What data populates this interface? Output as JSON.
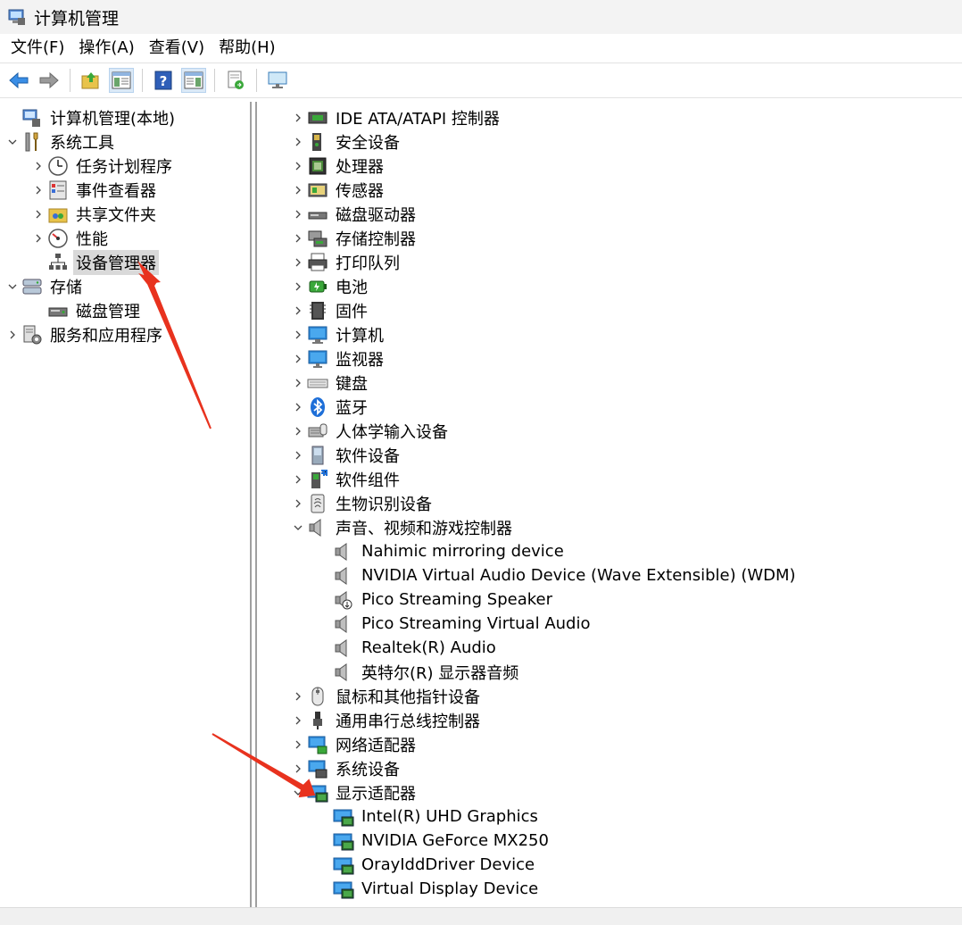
{
  "window": {
    "title": "计算机管理"
  },
  "menu": [
    "文件(F)",
    "操作(A)",
    "查看(V)",
    "帮助(H)"
  ],
  "toolbar_icons": [
    "back-arrow-icon",
    "forward-arrow-icon",
    "up-folder-icon",
    "show-tree-icon",
    "help-icon",
    "properties-icon",
    "export-icon",
    "monitor-icon"
  ],
  "left_tree": [
    {
      "label": "计算机管理(本地)",
      "icon": "computer-management-icon",
      "level": 0,
      "expander": "none"
    },
    {
      "label": "系统工具",
      "icon": "tools-icon",
      "level": 0,
      "expander": "open"
    },
    {
      "label": "任务计划程序",
      "icon": "clock-icon",
      "level": 1,
      "expander": "closed"
    },
    {
      "label": "事件查看器",
      "icon": "event-viewer-icon",
      "level": 1,
      "expander": "closed"
    },
    {
      "label": "共享文件夹",
      "icon": "shared-folder-icon",
      "level": 1,
      "expander": "closed"
    },
    {
      "label": "性能",
      "icon": "performance-icon",
      "level": 1,
      "expander": "closed"
    },
    {
      "label": "设备管理器",
      "icon": "device-manager-icon",
      "level": 1,
      "expander": "none",
      "selected": true
    },
    {
      "label": "存储",
      "icon": "storage-icon",
      "level": 0,
      "expander": "open"
    },
    {
      "label": "磁盘管理",
      "icon": "disk-management-icon",
      "level": 1,
      "expander": "none"
    },
    {
      "label": "服务和应用程序",
      "icon": "services-icon",
      "level": 0,
      "expander": "closed"
    }
  ],
  "device_tree": [
    {
      "label": "IDE ATA/ATAPI 控制器",
      "icon": "ide-controller-icon",
      "level": 0,
      "expander": "closed"
    },
    {
      "label": "安全设备",
      "icon": "security-device-icon",
      "level": 0,
      "expander": "closed"
    },
    {
      "label": "处理器",
      "icon": "processor-icon",
      "level": 0,
      "expander": "closed"
    },
    {
      "label": "传感器",
      "icon": "sensor-icon",
      "level": 0,
      "expander": "closed"
    },
    {
      "label": "磁盘驱动器",
      "icon": "disk-drive-icon",
      "level": 0,
      "expander": "closed"
    },
    {
      "label": "存储控制器",
      "icon": "storage-controller-icon",
      "level": 0,
      "expander": "closed"
    },
    {
      "label": "打印队列",
      "icon": "printer-icon",
      "level": 0,
      "expander": "closed"
    },
    {
      "label": "电池",
      "icon": "battery-icon",
      "level": 0,
      "expander": "closed"
    },
    {
      "label": "固件",
      "icon": "firmware-icon",
      "level": 0,
      "expander": "closed"
    },
    {
      "label": "计算机",
      "icon": "computer-icon",
      "level": 0,
      "expander": "closed"
    },
    {
      "label": "监视器",
      "icon": "monitor-icon",
      "level": 0,
      "expander": "closed"
    },
    {
      "label": "键盘",
      "icon": "keyboard-icon",
      "level": 0,
      "expander": "closed"
    },
    {
      "label": "蓝牙",
      "icon": "bluetooth-icon",
      "level": 0,
      "expander": "closed"
    },
    {
      "label": "人体学输入设备",
      "icon": "hid-icon",
      "level": 0,
      "expander": "closed"
    },
    {
      "label": "软件设备",
      "icon": "software-device-icon",
      "level": 0,
      "expander": "closed"
    },
    {
      "label": "软件组件",
      "icon": "software-component-icon",
      "level": 0,
      "expander": "closed"
    },
    {
      "label": "生物识别设备",
      "icon": "biometric-icon",
      "level": 0,
      "expander": "closed"
    },
    {
      "label": "声音、视频和游戏控制器",
      "icon": "speaker-icon",
      "level": 0,
      "expander": "open"
    },
    {
      "label": "Nahimic mirroring device",
      "icon": "speaker-icon",
      "level": 1,
      "expander": "none"
    },
    {
      "label": "NVIDIA Virtual Audio Device (Wave Extensible) (WDM)",
      "icon": "speaker-icon",
      "level": 1,
      "expander": "none"
    },
    {
      "label": "Pico Streaming Speaker",
      "icon": "speaker-download-icon",
      "level": 1,
      "expander": "none"
    },
    {
      "label": "Pico Streaming Virtual Audio",
      "icon": "speaker-icon",
      "level": 1,
      "expander": "none"
    },
    {
      "label": "Realtek(R) Audio",
      "icon": "speaker-icon",
      "level": 1,
      "expander": "none"
    },
    {
      "label": "英特尔(R) 显示器音频",
      "icon": "speaker-icon",
      "level": 1,
      "expander": "none"
    },
    {
      "label": "鼠标和其他指针设备",
      "icon": "mouse-icon",
      "level": 0,
      "expander": "closed"
    },
    {
      "label": "通用串行总线控制器",
      "icon": "usb-icon",
      "level": 0,
      "expander": "closed"
    },
    {
      "label": "网络适配器",
      "icon": "network-adapter-icon",
      "level": 0,
      "expander": "closed"
    },
    {
      "label": "系统设备",
      "icon": "system-device-icon",
      "level": 0,
      "expander": "closed"
    },
    {
      "label": "显示适配器",
      "icon": "display-adapter-icon",
      "level": 0,
      "expander": "open"
    },
    {
      "label": "Intel(R) UHD Graphics",
      "icon": "display-adapter-icon",
      "level": 1,
      "expander": "none"
    },
    {
      "label": "NVIDIA GeForce MX250",
      "icon": "display-adapter-icon",
      "level": 1,
      "expander": "none"
    },
    {
      "label": "OrayIddDriver Device",
      "icon": "display-adapter-icon",
      "level": 1,
      "expander": "none"
    },
    {
      "label": "Virtual Display Device",
      "icon": "display-adapter-icon",
      "level": 1,
      "expander": "none"
    }
  ],
  "colors": {
    "annotation_arrow": "#e8321e",
    "selection": "#d9d9d9"
  }
}
